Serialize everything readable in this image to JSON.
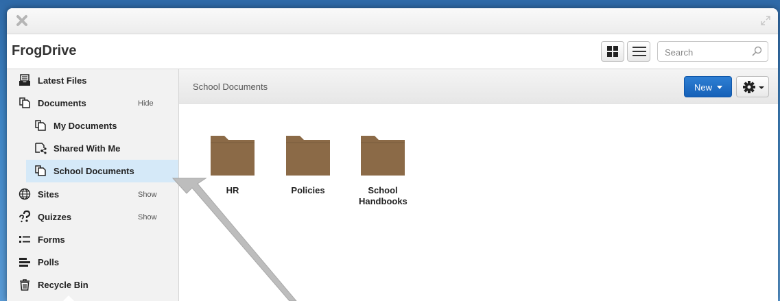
{
  "app": {
    "title": "FrogDrive"
  },
  "search": {
    "placeholder": "Search",
    "value": ""
  },
  "sidebar": {
    "items": [
      {
        "label": "Latest Files",
        "icon": "inbox-tray-icon",
        "action": ""
      },
      {
        "label": "Documents",
        "icon": "documents-icon",
        "action": "Hide"
      },
      {
        "label": "My Documents",
        "icon": "documents-icon",
        "action": ""
      },
      {
        "label": "Shared With Me",
        "icon": "shared-icon",
        "action": ""
      },
      {
        "label": "School Documents",
        "icon": "documents-icon",
        "action": "",
        "selected": true
      },
      {
        "label": "Sites",
        "icon": "globe-icon",
        "action": "Show"
      },
      {
        "label": "Quizzes",
        "icon": "question-icon",
        "action": "Show"
      },
      {
        "label": "Forms",
        "icon": "list-icon",
        "action": ""
      },
      {
        "label": "Polls",
        "icon": "bars-icon",
        "action": ""
      },
      {
        "label": "Recycle Bin",
        "icon": "trash-icon",
        "action": ""
      }
    ]
  },
  "content": {
    "breadcrumb": "School Documents",
    "new_label": "New",
    "folders": [
      {
        "name": "HR"
      },
      {
        "name": "Policies"
      },
      {
        "name": "School Handbooks"
      }
    ]
  },
  "colors": {
    "accent_blue": "#1a6cc8",
    "selected_row": "#d5e9f8",
    "folder_brown": "#8b6a47"
  }
}
